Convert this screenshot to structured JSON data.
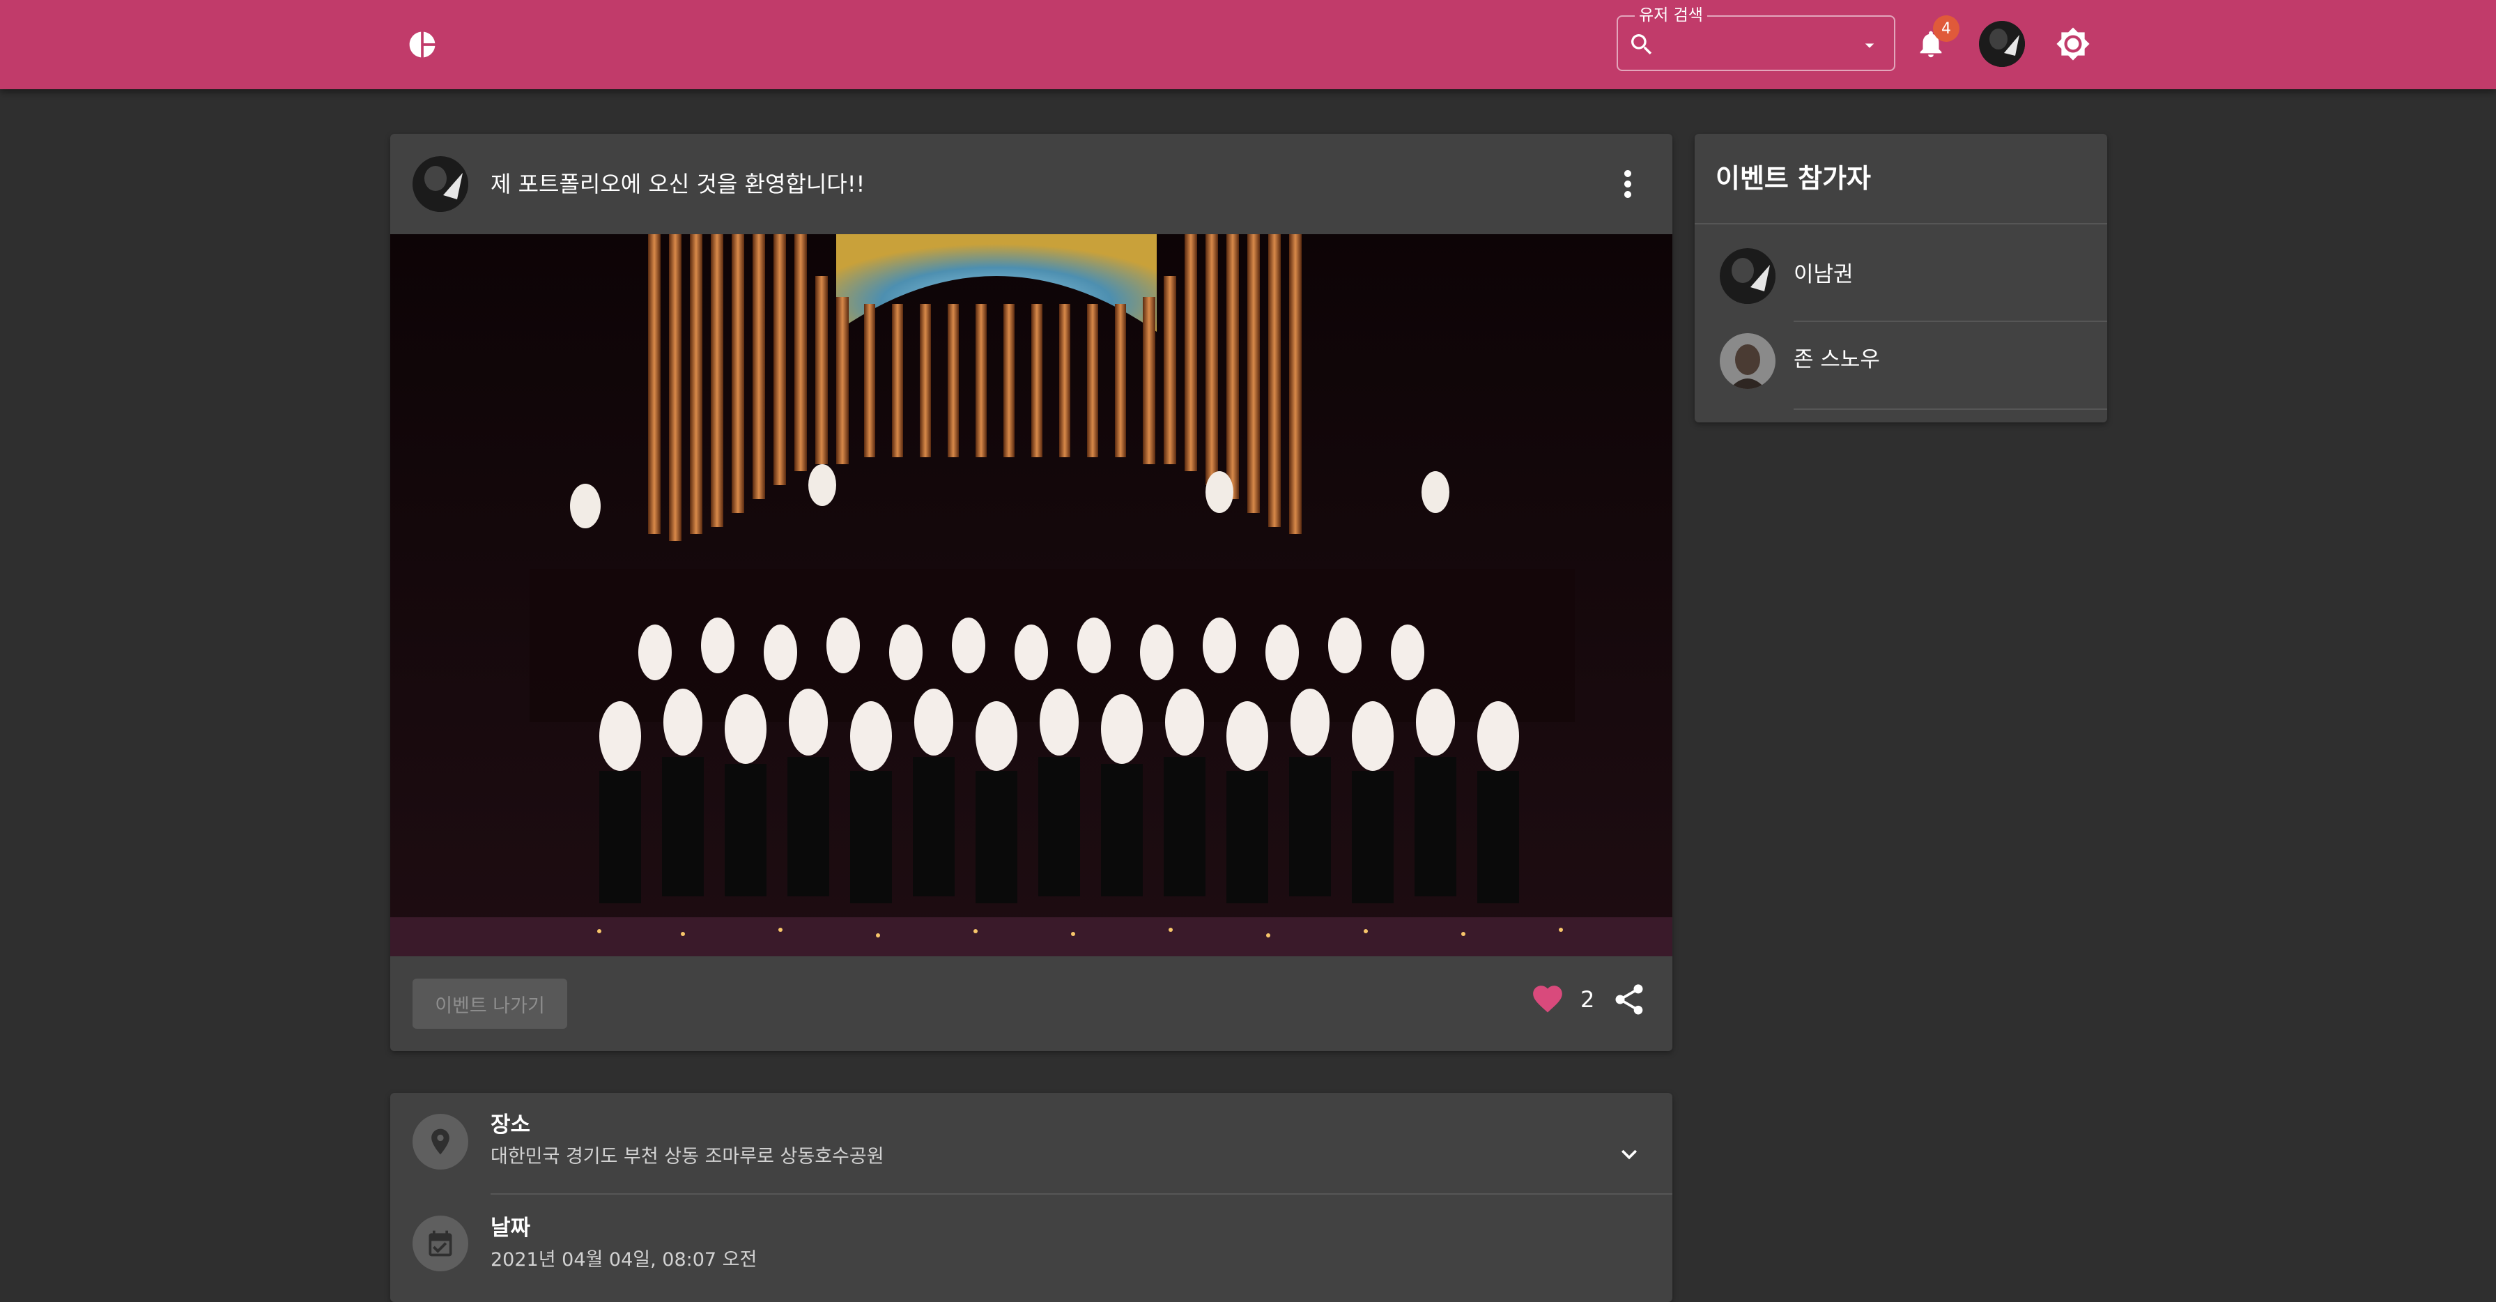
{
  "header": {
    "search_label": "유저 검색",
    "search_value": "",
    "notification_count": "4",
    "brand_color": "#c13b6a"
  },
  "post": {
    "title": "제 포트폴리오에 오신 것을 환영합니다!!",
    "image_description_icon": "photo",
    "leave_button_label": "이벤트 나가기",
    "like_count": "2"
  },
  "participants": {
    "title": "이벤트 참가자",
    "items": [
      {
        "name": "이남권"
      },
      {
        "name": "존 스노우"
      }
    ]
  },
  "details": {
    "location_label": "장소",
    "location_value": "대한민국 경기도 부천 상동 조마루로 상동호수공원",
    "date_label": "날짜",
    "date_value": "2021년 04월 04일, 08:07 오전"
  },
  "icons": {
    "logo": "chart-pie-icon",
    "search": "search-icon",
    "dropdown": "arrow-drop-down-icon",
    "bell": "bell-icon",
    "theme": "brightness-icon",
    "more": "more-vert-icon",
    "heart": "heart-icon",
    "share": "share-icon",
    "location": "location-pin-icon",
    "calendar": "calendar-icon",
    "expand": "chevron-down-icon"
  },
  "colors": {
    "background": "#2f2f2f",
    "card": "#424242",
    "heart": "#d94a7c",
    "badge": "#e05a3a"
  }
}
